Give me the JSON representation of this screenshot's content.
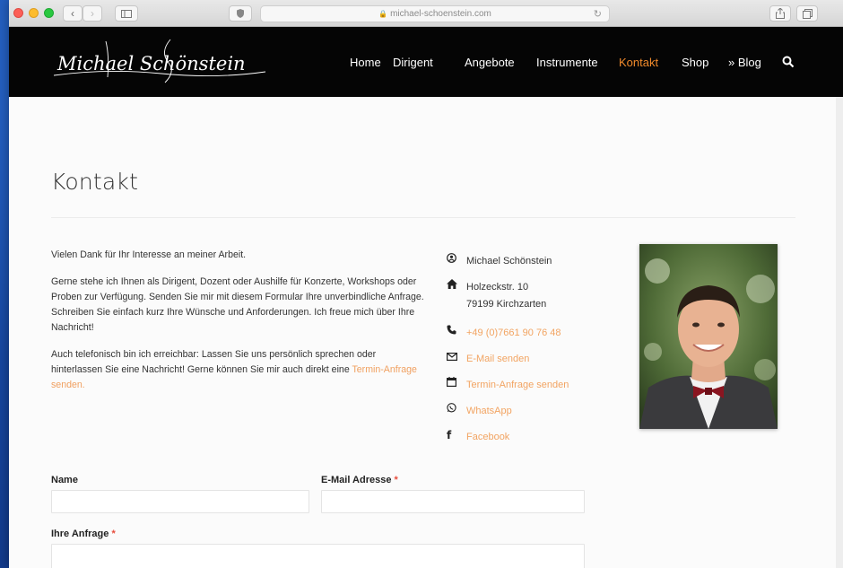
{
  "browser": {
    "url": "michael-schoenstein.com"
  },
  "header": {
    "logo_text": "Michael Schönstein",
    "nav": [
      {
        "label": "Home",
        "active": false
      },
      {
        "label": "Dirigent",
        "active": false
      },
      {
        "label": "Angebote",
        "active": false
      },
      {
        "label": "Instrumente",
        "active": false
      },
      {
        "label": "Kontakt",
        "active": true
      },
      {
        "label": "Shop",
        "active": false
      },
      {
        "label": "» Blog",
        "active": false
      }
    ],
    "accent_color": "#f08a2b"
  },
  "page": {
    "title": "Kontakt",
    "intro": {
      "p1": "Vielen Dank für Ihr Interesse an meiner Arbeit.",
      "p2": "Gerne stehe ich Ihnen als Dirigent, Dozent oder Aushilfe für Konzerte, Workshops oder Proben zur Verfügung. Senden Sie mir mit diesem Formular Ihre unverbindliche Anfrage. Schreiben Sie einfach kurz Ihre Wünsche und Anforderungen. Ich freue mich über Ihre Nachricht!",
      "p3": "Auch telefonisch bin ich erreichbar: Lassen Sie uns persönlich sprechen oder hinterlassen Sie eine Nachricht! Gerne können Sie mir auch direkt eine",
      "p3_link": "Termin-Anfrage senden."
    },
    "contact": {
      "name": "Michael Schönstein",
      "street": "Holzeckstr. 10",
      "city": "79199 Kirchzarten",
      "phone": "+49 (0)7661 90 76 48",
      "email_link": "E-Mail senden",
      "appointment_link": "Termin-Anfrage senden",
      "whatsapp_link": "WhatsApp",
      "facebook_link": "Facebook"
    },
    "form": {
      "name_label": "Name",
      "email_label": "E-Mail Adresse",
      "request_label": "Ihre Anfrage",
      "required_mark": "*"
    }
  }
}
